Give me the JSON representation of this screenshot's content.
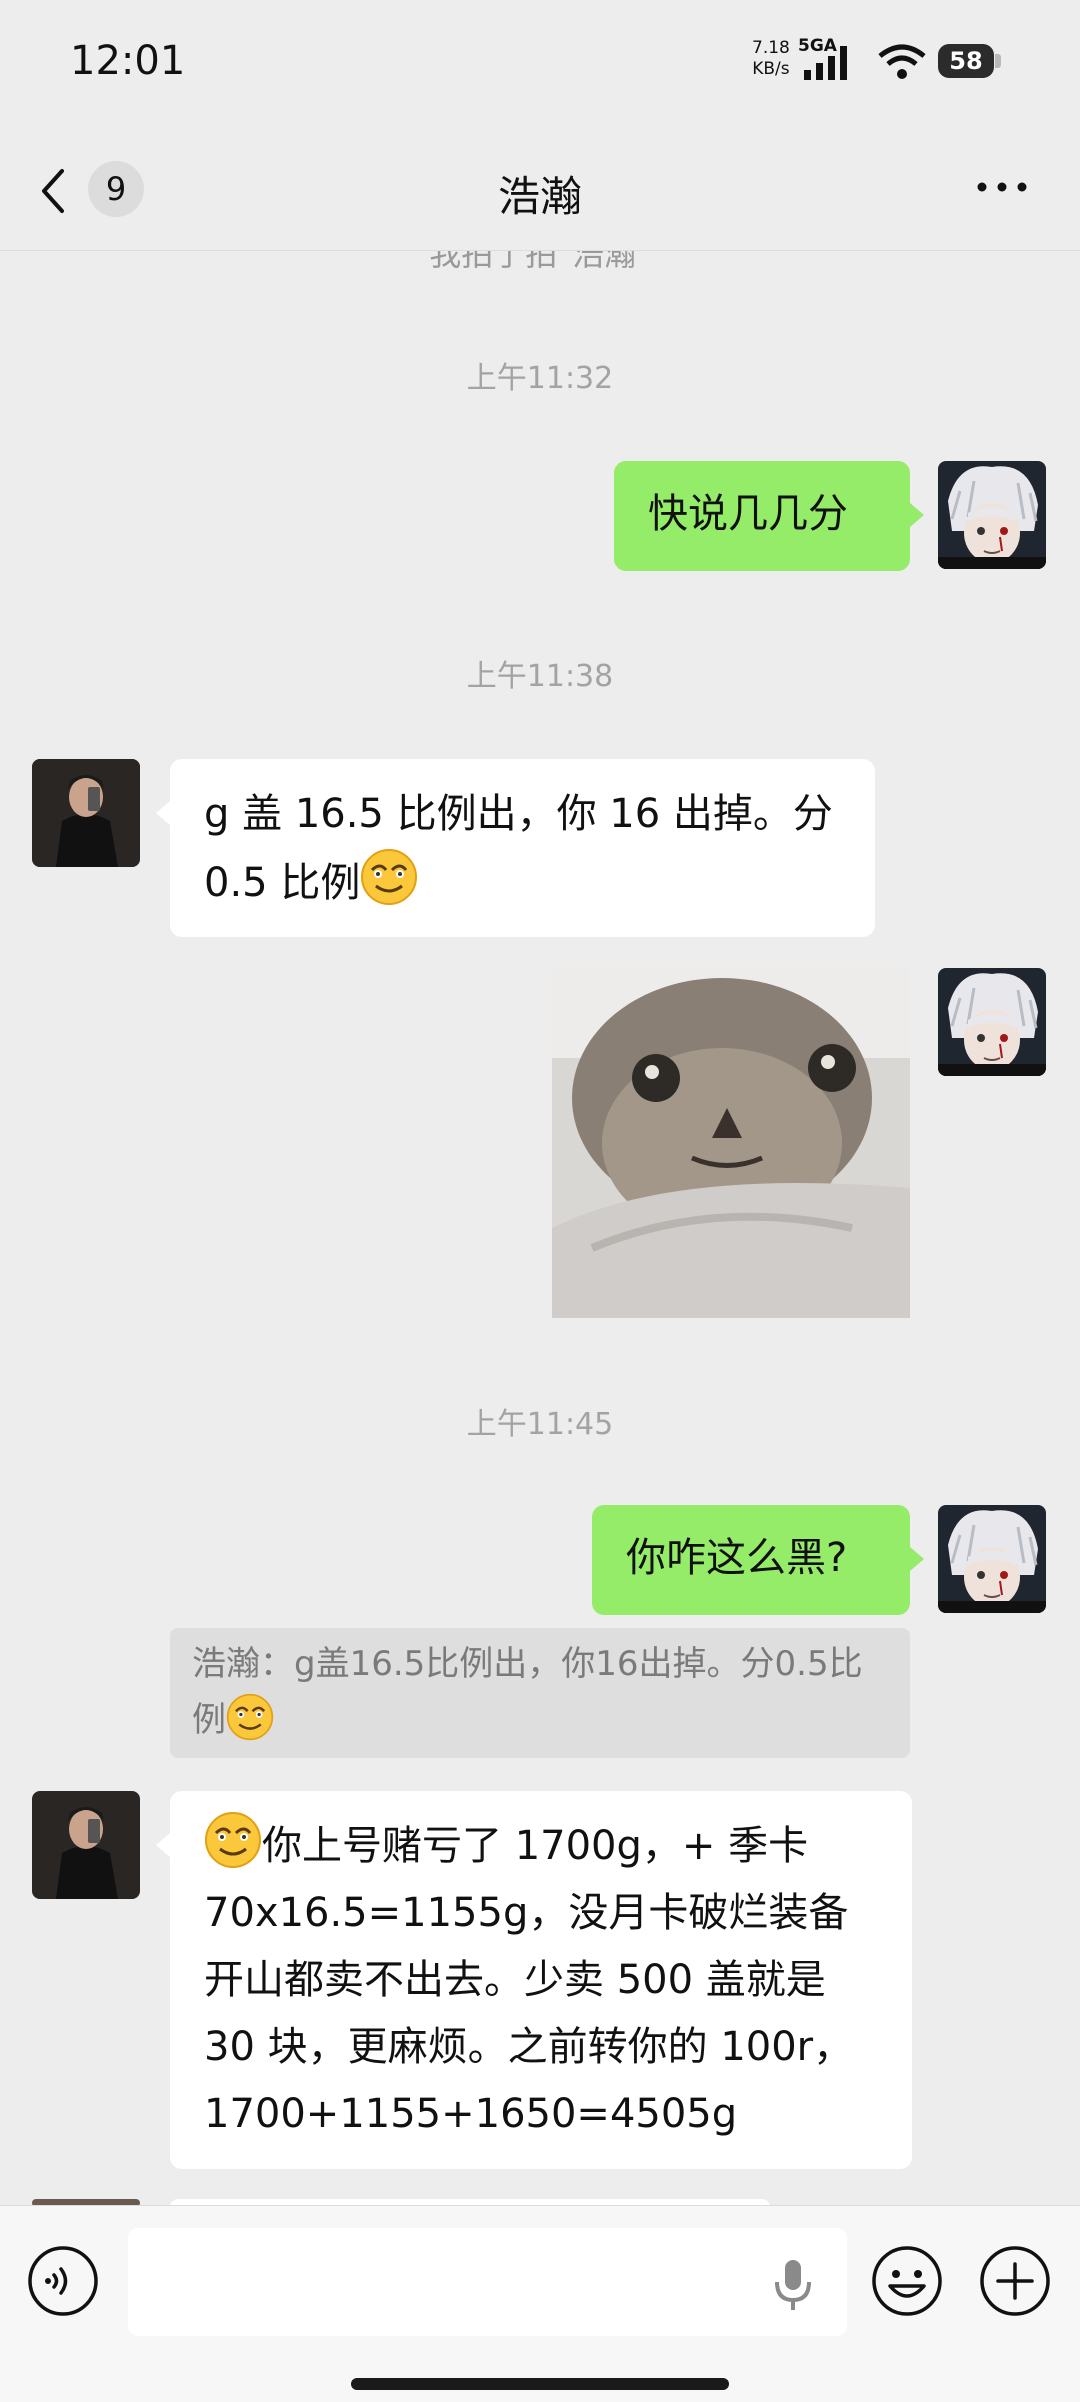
{
  "status_bar": {
    "time": "12:01",
    "net_speed_value": "7.18",
    "net_speed_unit": "KB/s",
    "signal_label": "5GA",
    "battery": "58"
  },
  "nav": {
    "back_badge": "9",
    "title": "浩瀚"
  },
  "chat": {
    "cutoff_text": "我拍了拍\"浩瀚\"",
    "timestamps": [
      "上午11:32",
      "上午11:38",
      "上午11:45"
    ],
    "messages": [
      {
        "side": "out",
        "lines": [
          "快说几几分"
        ]
      },
      {
        "side": "in",
        "lines": [
          "g 盖 16.5 比例出，你 16 出掉。分",
          "0.5 比例"
        ]
      },
      {
        "side": "out",
        "type": "sticker",
        "content": "cat-sticker"
      },
      {
        "side": "out",
        "lines": [
          "你咋这么黑?"
        ]
      },
      {
        "side": "in",
        "lines": [
          "你上号赌亏了 1700g，+ 季卡",
          "70x16.5=1155g，没月卡破烂装备",
          "开山都卖不出去。少卖 500 盖就是",
          "30 块，更麻烦。之前转你的 100r，",
          "1700+1155+1650=4505g"
        ]
      }
    ],
    "quote": {
      "lines": [
        "浩瀚：g盖16.5比例出，你16出掉。分0.5比",
        "例"
      ]
    }
  },
  "input_bar": {
    "text_value": ""
  },
  "colors": {
    "outgoing_bubble": "#95ec69",
    "incoming_bubble": "#ffffff",
    "background": "#ededed"
  },
  "icons": [
    "back-chevron-icon",
    "more-dots-icon",
    "voice-icon",
    "microphone-icon",
    "emoji-icon",
    "plus-icon",
    "grinning-emoji-icon"
  ]
}
